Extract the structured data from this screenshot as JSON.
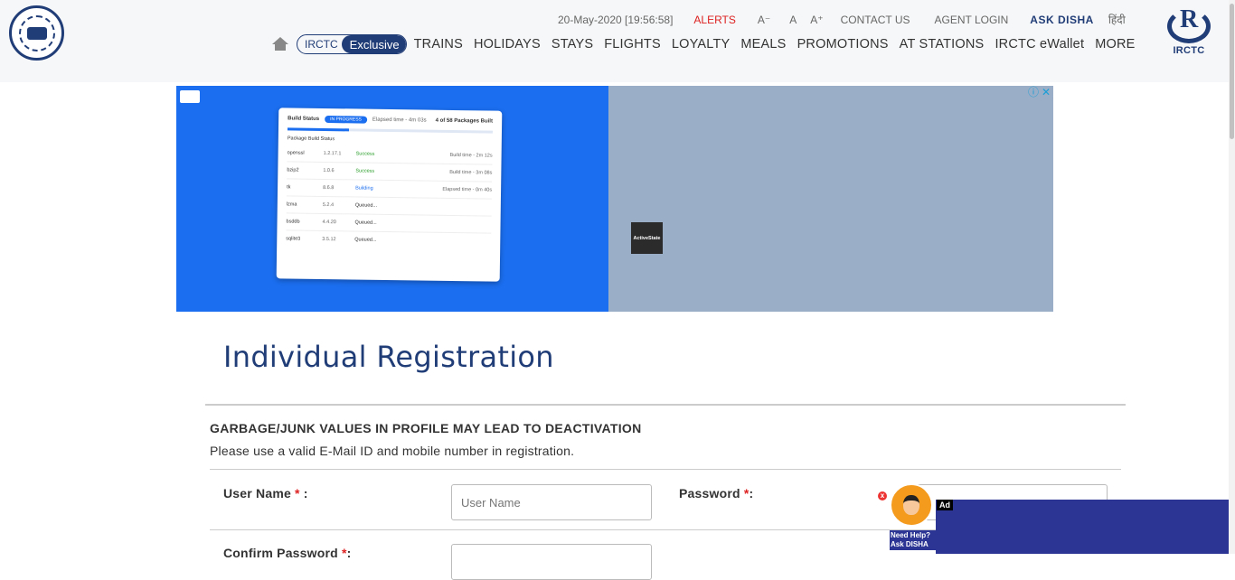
{
  "header": {
    "date_time": "20-May-2020 [19:56:58]",
    "alerts": "ALERTS",
    "font_small": "A⁻",
    "font_normal": "A",
    "font_large": "A⁺",
    "contact_us": "CONTACT US",
    "agent_login": "AGENT LOGIN",
    "ask_disha": "ASK DISHA",
    "hindi": "हिंदी",
    "right_logo_caption": "IRCTC",
    "right_logo_letter": "R",
    "nav": {
      "home_icon": "home-icon",
      "exclusive_a": "IRCTC",
      "exclusive_b": "Exclusive",
      "items": [
        "TRAINS",
        "HOLIDAYS",
        "STAYS",
        "FLIGHTS",
        "LOYALTY",
        "MEALS",
        "PROMOTIONS",
        "AT STATIONS",
        "IRCTC eWallet",
        "MORE"
      ]
    }
  },
  "ad": {
    "card": {
      "build_status": "Build Status",
      "in_progress": "IN PROGRESS",
      "elapsed": "Elapsed time - 4m 03s",
      "packages_built": "4 of 58 Packages Built",
      "package_build_status": "Package Build Status",
      "rows": [
        {
          "name": "openssl",
          "version": "1.2.17.1",
          "status": "Success",
          "time": "Build time - 2m 12s"
        },
        {
          "name": "bzip2",
          "version": "1.0.6",
          "status": "Success",
          "time": "Build time - 3m 08s"
        },
        {
          "name": "tk",
          "version": "8.6.8",
          "status": "Building",
          "time": "Elapsed time - 0m 40s"
        },
        {
          "name": "lzma",
          "version": "5.2.4",
          "status": "Queued...",
          "time": ""
        },
        {
          "name": "bsddb",
          "version": "4.4.20",
          "status": "Queued...",
          "time": ""
        },
        {
          "name": "sqlite3",
          "version": "3.5.12",
          "status": "Queued...",
          "time": ""
        }
      ]
    },
    "brand": "ActiveState",
    "info_icon": "ⓘ",
    "close_icon": "✕"
  },
  "main": {
    "title": "Individual Registration",
    "warning": "GARBAGE/JUNK VALUES IN PROFILE MAY LEAD TO DEACTIVATION",
    "note": "Please use a valid E-Mail ID and mobile number in registration.",
    "username_label": "User Name",
    "username_placeholder": "User Name",
    "password_label": "Password",
    "confirm_password_label": "Confirm Password",
    "required_mark": "*",
    "colon": ":"
  },
  "disha": {
    "help_line1": "Need Help?",
    "help_line2": "Ask DISHA",
    "close": "x",
    "ad_tag": "Ad"
  }
}
